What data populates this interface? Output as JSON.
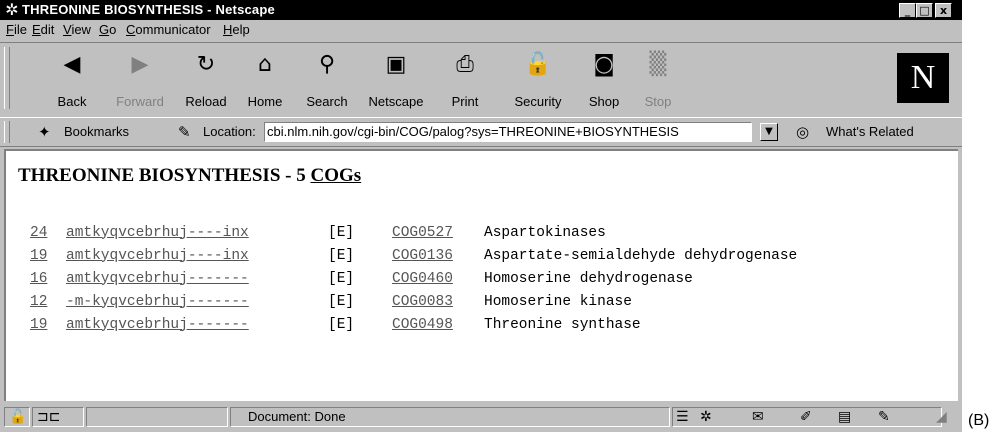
{
  "window": {
    "title": "THREONINE BIOSYNTHESIS - Netscape",
    "controls": {
      "minimize": "_",
      "maximize": "□",
      "close": "x"
    }
  },
  "menu": [
    {
      "label": "File"
    },
    {
      "label": "Edit"
    },
    {
      "label": "View"
    },
    {
      "label": "Go"
    },
    {
      "label": "Communicator"
    },
    {
      "label": "Help"
    }
  ],
  "toolbar": {
    "buttons": [
      {
        "label": "Back",
        "icon": "back-arrow-icon",
        "glyph": "◀",
        "enabled": true
      },
      {
        "label": "Forward",
        "icon": "forward-arrow-icon",
        "glyph": "▶",
        "enabled": false
      },
      {
        "label": "Reload",
        "icon": "reload-icon",
        "glyph": "↻",
        "enabled": true
      },
      {
        "label": "Home",
        "icon": "home-icon",
        "glyph": "⌂",
        "enabled": true
      },
      {
        "label": "Search",
        "icon": "search-icon",
        "glyph": "⚲",
        "enabled": true
      },
      {
        "label": "Netscape",
        "icon": "my-netscape-icon",
        "glyph": "▣",
        "enabled": true
      },
      {
        "label": "Print",
        "icon": "printer-icon",
        "glyph": "⎙",
        "enabled": true
      },
      {
        "label": "Security",
        "icon": "lock-icon",
        "glyph": "🔓",
        "enabled": true
      },
      {
        "label": "Shop",
        "icon": "shop-icon",
        "glyph": "◙",
        "enabled": true
      },
      {
        "label": "Stop",
        "icon": "stop-icon",
        "glyph": "▒",
        "enabled": false
      }
    ],
    "logo": "N"
  },
  "location_bar": {
    "bookmarks_label": "Bookmarks",
    "location_label": "Location:",
    "url": "cbi.nlm.nih.gov/cgi-bin/COG/palog?sys=THREONINE+BIOSYNTHESIS",
    "related_label": "What's Related"
  },
  "page": {
    "title_prefix": "THREONINE BIOSYNTHESIS - 5 ",
    "title_link": "COGs",
    "rows": [
      {
        "count": "24",
        "pattern": "amtkyqvcebrhuj----inx",
        "category": "[E]",
        "cog_id": "COG0527",
        "name": "Aspartokinases"
      },
      {
        "count": "19",
        "pattern": "amtkyqvcebrhuj----inx",
        "category": "[E]",
        "cog_id": "COG0136",
        "name": "Aspartate-semialdehyde dehydrogenase"
      },
      {
        "count": "16",
        "pattern": "amtkyqvcebrhuj-------",
        "category": "[E]",
        "cog_id": "COG0460",
        "name": "Homoserine dehydrogenase"
      },
      {
        "count": "12",
        "pattern": "-m-kyqvcebrhuj-------",
        "category": "[E]",
        "cog_id": "COG0083",
        "name": "Homoserine kinase"
      },
      {
        "count": "19",
        "pattern": "amtkyqvcebrhuj-------",
        "category": "[E]",
        "cog_id": "COG0498",
        "name": "Threonine synthase"
      }
    ]
  },
  "status_bar": {
    "status": "Document: Done"
  },
  "figure_label": "(B)",
  "colors": {
    "chrome": "#c0c0c0",
    "titlebar": "#000000",
    "link": "#555555"
  }
}
